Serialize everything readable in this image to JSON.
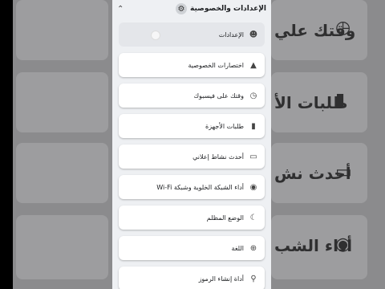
{
  "header": {
    "title": "الإعدادات والخصوصية",
    "icon": "gear-icon",
    "chevron": "chevron-up-icon"
  },
  "menu": [
    {
      "label": "الإعدادات",
      "icon": "profile-icon",
      "glyph": "☻",
      "active": true
    },
    {
      "label": "اختصارات الخصوصية",
      "icon": "lock-person-icon",
      "glyph": "▲",
      "active": false
    },
    {
      "label": "وقتك على فيسبوك",
      "icon": "clock-icon",
      "glyph": "◷",
      "active": false
    },
    {
      "label": "طلبات الأجهزة",
      "icon": "phone-check-icon",
      "glyph": "▮",
      "active": false
    },
    {
      "label": "أحدث نشاط إعلاني",
      "icon": "ad-activity-icon",
      "glyph": "▭",
      "active": false
    },
    {
      "label": "أداء الشبكة الخلوية وشبكة Wi-Fi",
      "icon": "wifi-icon",
      "glyph": "◉",
      "active": false
    },
    {
      "label": "الوضع المظلم",
      "icon": "moon-icon",
      "glyph": "☾",
      "active": false
    },
    {
      "label": "اللغة",
      "icon": "globe-icon",
      "glyph": "⊕",
      "active": false
    },
    {
      "label": "أداة إنشاء الرموز",
      "icon": "key-icon",
      "glyph": "⚲",
      "active": false
    }
  ],
  "background": {
    "texts": [
      "وقتك علي",
      "طلبات الأ",
      "أحدث نش",
      "أداء الشب"
    ]
  }
}
